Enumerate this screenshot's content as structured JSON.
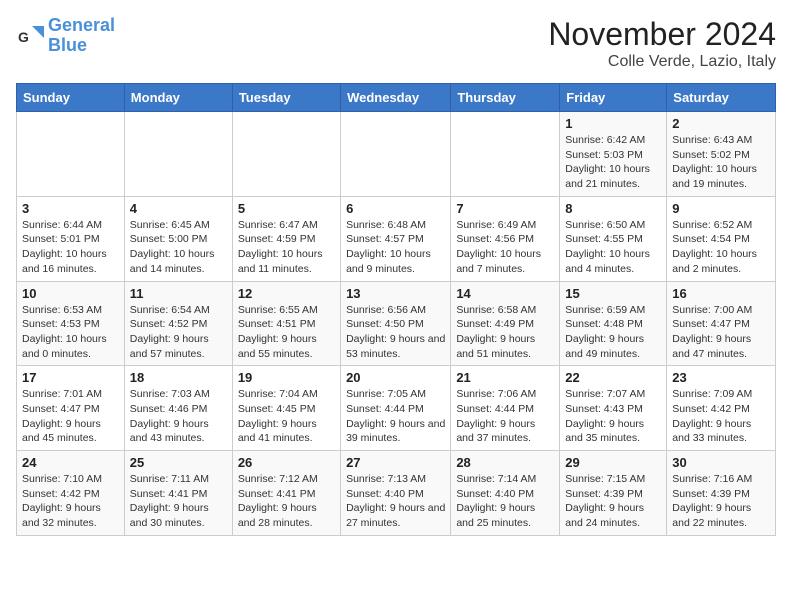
{
  "logo": {
    "line1": "General",
    "line2": "Blue"
  },
  "title": "November 2024",
  "location": "Colle Verde, Lazio, Italy",
  "weekdays": [
    "Sunday",
    "Monday",
    "Tuesday",
    "Wednesday",
    "Thursday",
    "Friday",
    "Saturday"
  ],
  "weeks": [
    [
      {
        "day": "",
        "info": ""
      },
      {
        "day": "",
        "info": ""
      },
      {
        "day": "",
        "info": ""
      },
      {
        "day": "",
        "info": ""
      },
      {
        "day": "",
        "info": ""
      },
      {
        "day": "1",
        "info": "Sunrise: 6:42 AM\nSunset: 5:03 PM\nDaylight: 10 hours and 21 minutes."
      },
      {
        "day": "2",
        "info": "Sunrise: 6:43 AM\nSunset: 5:02 PM\nDaylight: 10 hours and 19 minutes."
      }
    ],
    [
      {
        "day": "3",
        "info": "Sunrise: 6:44 AM\nSunset: 5:01 PM\nDaylight: 10 hours and 16 minutes."
      },
      {
        "day": "4",
        "info": "Sunrise: 6:45 AM\nSunset: 5:00 PM\nDaylight: 10 hours and 14 minutes."
      },
      {
        "day": "5",
        "info": "Sunrise: 6:47 AM\nSunset: 4:59 PM\nDaylight: 10 hours and 11 minutes."
      },
      {
        "day": "6",
        "info": "Sunrise: 6:48 AM\nSunset: 4:57 PM\nDaylight: 10 hours and 9 minutes."
      },
      {
        "day": "7",
        "info": "Sunrise: 6:49 AM\nSunset: 4:56 PM\nDaylight: 10 hours and 7 minutes."
      },
      {
        "day": "8",
        "info": "Sunrise: 6:50 AM\nSunset: 4:55 PM\nDaylight: 10 hours and 4 minutes."
      },
      {
        "day": "9",
        "info": "Sunrise: 6:52 AM\nSunset: 4:54 PM\nDaylight: 10 hours and 2 minutes."
      }
    ],
    [
      {
        "day": "10",
        "info": "Sunrise: 6:53 AM\nSunset: 4:53 PM\nDaylight: 10 hours and 0 minutes."
      },
      {
        "day": "11",
        "info": "Sunrise: 6:54 AM\nSunset: 4:52 PM\nDaylight: 9 hours and 57 minutes."
      },
      {
        "day": "12",
        "info": "Sunrise: 6:55 AM\nSunset: 4:51 PM\nDaylight: 9 hours and 55 minutes."
      },
      {
        "day": "13",
        "info": "Sunrise: 6:56 AM\nSunset: 4:50 PM\nDaylight: 9 hours and 53 minutes."
      },
      {
        "day": "14",
        "info": "Sunrise: 6:58 AM\nSunset: 4:49 PM\nDaylight: 9 hours and 51 minutes."
      },
      {
        "day": "15",
        "info": "Sunrise: 6:59 AM\nSunset: 4:48 PM\nDaylight: 9 hours and 49 minutes."
      },
      {
        "day": "16",
        "info": "Sunrise: 7:00 AM\nSunset: 4:47 PM\nDaylight: 9 hours and 47 minutes."
      }
    ],
    [
      {
        "day": "17",
        "info": "Sunrise: 7:01 AM\nSunset: 4:47 PM\nDaylight: 9 hours and 45 minutes."
      },
      {
        "day": "18",
        "info": "Sunrise: 7:03 AM\nSunset: 4:46 PM\nDaylight: 9 hours and 43 minutes."
      },
      {
        "day": "19",
        "info": "Sunrise: 7:04 AM\nSunset: 4:45 PM\nDaylight: 9 hours and 41 minutes."
      },
      {
        "day": "20",
        "info": "Sunrise: 7:05 AM\nSunset: 4:44 PM\nDaylight: 9 hours and 39 minutes."
      },
      {
        "day": "21",
        "info": "Sunrise: 7:06 AM\nSunset: 4:44 PM\nDaylight: 9 hours and 37 minutes."
      },
      {
        "day": "22",
        "info": "Sunrise: 7:07 AM\nSunset: 4:43 PM\nDaylight: 9 hours and 35 minutes."
      },
      {
        "day": "23",
        "info": "Sunrise: 7:09 AM\nSunset: 4:42 PM\nDaylight: 9 hours and 33 minutes."
      }
    ],
    [
      {
        "day": "24",
        "info": "Sunrise: 7:10 AM\nSunset: 4:42 PM\nDaylight: 9 hours and 32 minutes."
      },
      {
        "day": "25",
        "info": "Sunrise: 7:11 AM\nSunset: 4:41 PM\nDaylight: 9 hours and 30 minutes."
      },
      {
        "day": "26",
        "info": "Sunrise: 7:12 AM\nSunset: 4:41 PM\nDaylight: 9 hours and 28 minutes."
      },
      {
        "day": "27",
        "info": "Sunrise: 7:13 AM\nSunset: 4:40 PM\nDaylight: 9 hours and 27 minutes."
      },
      {
        "day": "28",
        "info": "Sunrise: 7:14 AM\nSunset: 4:40 PM\nDaylight: 9 hours and 25 minutes."
      },
      {
        "day": "29",
        "info": "Sunrise: 7:15 AM\nSunset: 4:39 PM\nDaylight: 9 hours and 24 minutes."
      },
      {
        "day": "30",
        "info": "Sunrise: 7:16 AM\nSunset: 4:39 PM\nDaylight: 9 hours and 22 minutes."
      }
    ]
  ]
}
